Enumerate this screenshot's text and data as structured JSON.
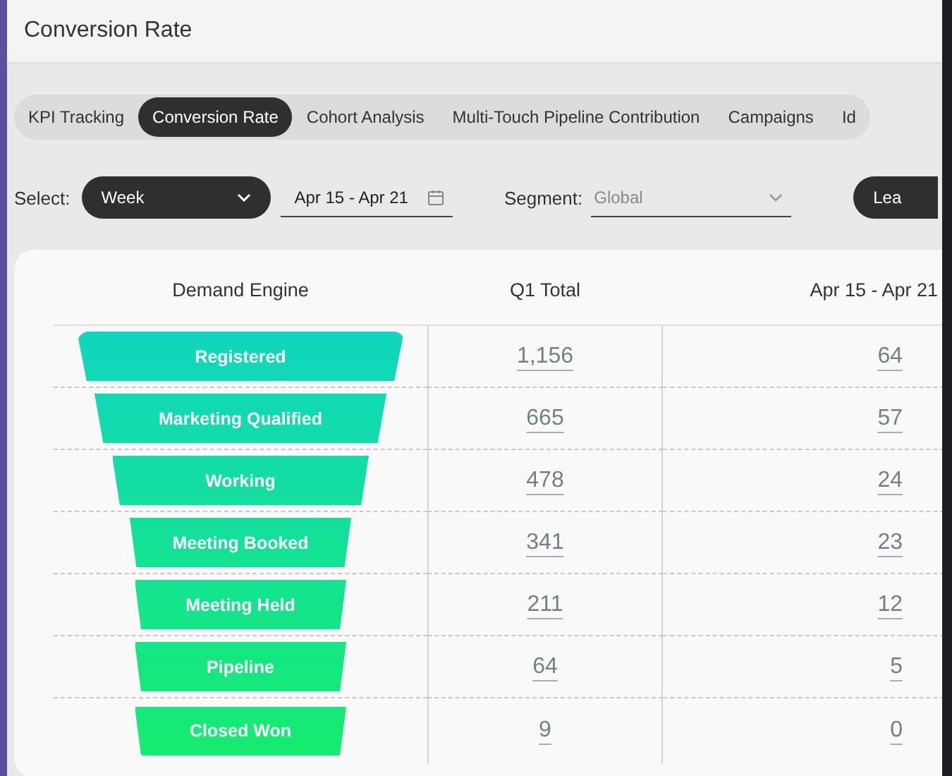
{
  "page": {
    "title": "Conversion Rate"
  },
  "tabs": [
    {
      "label": "KPI Tracking",
      "selected": false
    },
    {
      "label": "Conversion Rate",
      "selected": true
    },
    {
      "label": "Cohort Analysis",
      "selected": false
    },
    {
      "label": "Multi-Touch Pipeline Contribution",
      "selected": false
    },
    {
      "label": "Campaigns",
      "selected": false
    },
    {
      "label": "Id",
      "selected": false
    }
  ],
  "filters": {
    "select_label": "Select:",
    "period": "Week",
    "date_range": "Apr 15 - Apr 21",
    "segment_label": "Segment:",
    "segment": "Global",
    "button": "Lea"
  },
  "table": {
    "columns": [
      "Demand Engine",
      "Q1 Total",
      "Apr 15 - Apr 21"
    ],
    "rows": [
      {
        "stage": "Registered",
        "q1_total": "1,156",
        "week": "64"
      },
      {
        "stage": "Marketing Qualified",
        "q1_total": "665",
        "week": "57"
      },
      {
        "stage": "Working",
        "q1_total": "478",
        "week": "24"
      },
      {
        "stage": "Meeting Booked",
        "q1_total": "341",
        "week": "23"
      },
      {
        "stage": "Meeting Held",
        "q1_total": "211",
        "week": "12"
      },
      {
        "stage": "Pipeline",
        "q1_total": "64",
        "week": "5"
      },
      {
        "stage": "Closed Won",
        "q1_total": "9",
        "week": "0"
      }
    ]
  }
}
